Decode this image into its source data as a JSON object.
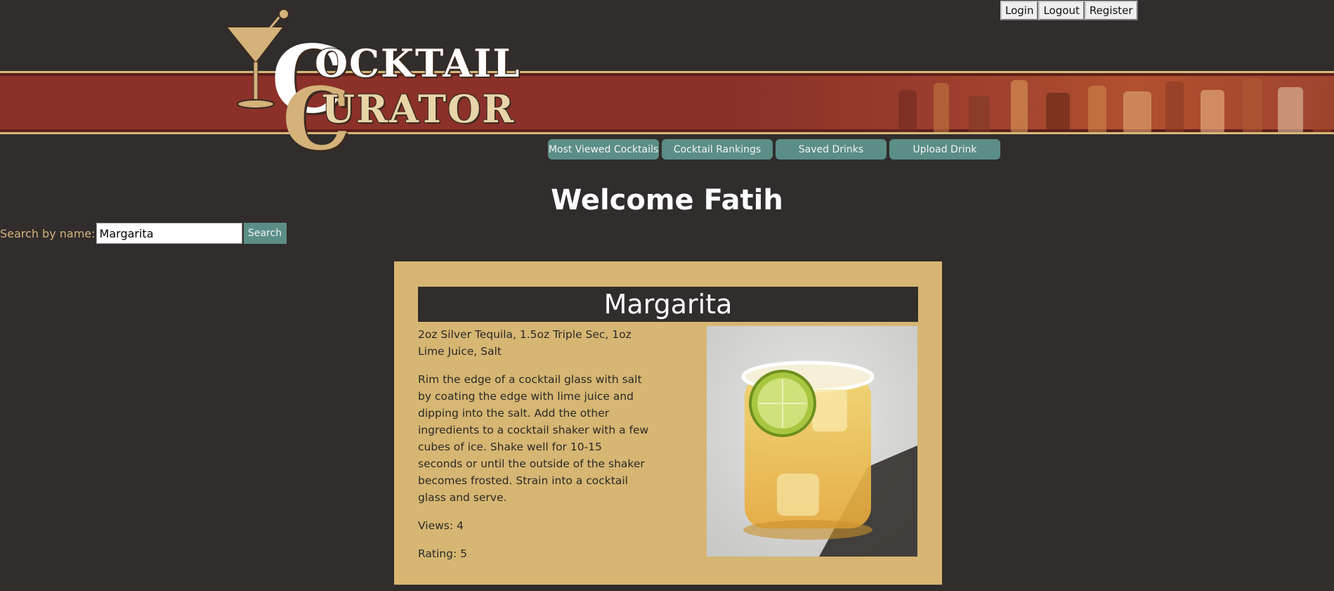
{
  "auth": {
    "login": "Login",
    "logout": "Logout",
    "register": "Register"
  },
  "logo": {
    "line1": "OCKTAIL",
    "line2": "URATOR",
    "initial1": "C",
    "initial2": "C"
  },
  "nav": [
    {
      "label": "Most Viewed Cocktails"
    },
    {
      "label": "Cocktail Rankings"
    },
    {
      "label": "Saved Drinks"
    },
    {
      "label": "Upload Drink"
    }
  ],
  "welcome": "Welcome Fatih",
  "search": {
    "label": "Search by name:",
    "value": "Margarita",
    "button": "Search"
  },
  "drink": {
    "name": "Margarita",
    "ingredients": "2oz Silver Tequila, 1.5oz Triple Sec, 1oz Lime Juice, Salt",
    "instructions": "Rim the edge of a cocktail glass with salt by coating the edge with lime juice and dipping into the salt. Add the other ingredients to a cocktail shaker with a few cubes of ice. Shake well for 10-15 seconds or until the outside of the shaker becomes frosted. Strain into a cocktail glass and serve.",
    "views": "Views: 4",
    "rating": "Rating: 5"
  },
  "colors": {
    "background": "#312d2c",
    "accent_gold": "#d6b672",
    "banner_red": "#8b3129",
    "button_teal": "#5b8e87"
  }
}
